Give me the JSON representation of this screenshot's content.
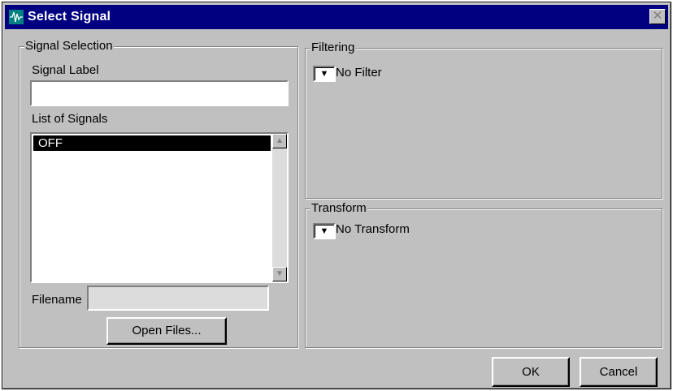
{
  "window": {
    "title": "Select Signal",
    "title_bar_color": "#000080",
    "icon": "waveform-icon"
  },
  "signal_selection": {
    "group_label": "Signal Selection",
    "signal_label_caption": "Signal Label",
    "signal_label_value": "",
    "list_caption": "List of Signals",
    "signals": [
      "OFF"
    ],
    "filename_caption": "Filename",
    "filename_value": "",
    "open_files_label": "Open Files..."
  },
  "filtering": {
    "group_label": "Filtering",
    "selected": "No Filter"
  },
  "transform": {
    "group_label": "Transform",
    "selected": "No Transform"
  },
  "buttons": {
    "ok": "OK",
    "cancel": "Cancel"
  },
  "icons": {
    "close": "close-icon",
    "scroll_up": "scroll-up-icon",
    "scroll_down": "scroll-down-icon",
    "dropdown": "dropdown-arrow-icon"
  }
}
